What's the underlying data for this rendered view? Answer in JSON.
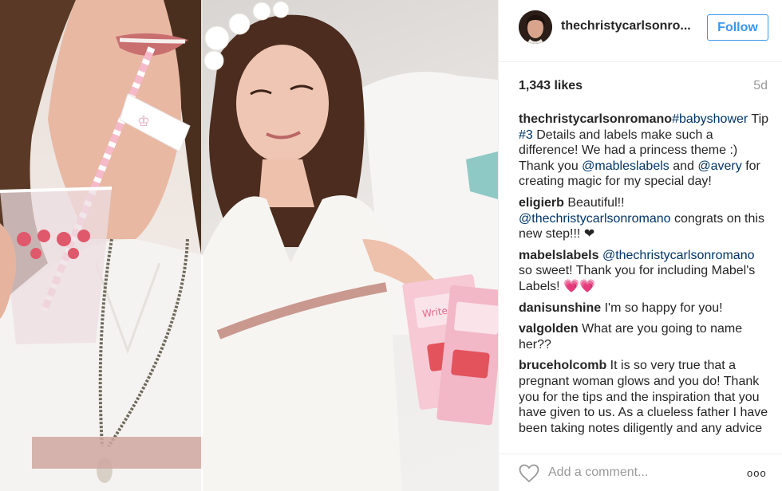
{
  "post": {
    "username_display": "thechristycarlsonro...",
    "follow_label": "Follow",
    "likes": "1,343 likes",
    "age": "5d"
  },
  "comments": [
    {
      "user": "thechristycarlsonromano",
      "parts": [
        {
          "t": "link",
          "v": "#babyshower"
        },
        {
          "t": "text",
          "v": " Tip "
        },
        {
          "t": "link",
          "v": "#3"
        },
        {
          "t": "text",
          "v": " Details and labels make such a difference! We had a princess theme :) Thank you "
        },
        {
          "t": "link",
          "v": "@mableslabels"
        },
        {
          "t": "text",
          "v": " and "
        },
        {
          "t": "link",
          "v": "@avery"
        },
        {
          "t": "text",
          "v": " for creating magic for my special day!"
        }
      ]
    },
    {
      "user": "eligierb",
      "parts": [
        {
          "t": "text",
          "v": " Beautiful!! "
        },
        {
          "t": "link",
          "v": "@thechristycarlsonromano"
        },
        {
          "t": "text",
          "v": " congrats on this new step!!! ❤"
        }
      ]
    },
    {
      "user": "mabelslabels",
      "parts": [
        {
          "t": "link",
          "v": " @thechristycarlsonromano"
        },
        {
          "t": "text",
          "v": " so sweet! Thank you for including Mabel's Labels! 💗💗"
        }
      ]
    },
    {
      "user": "danisunshine",
      "parts": [
        {
          "t": "text",
          "v": " I'm so happy for you!"
        }
      ]
    },
    {
      "user": "valgolden",
      "parts": [
        {
          "t": "text",
          "v": " What are you going to name her??"
        }
      ]
    },
    {
      "user": "bruceholcomb",
      "parts": [
        {
          "t": "text",
          "v": " It is so very true that a pregnant woman glows and you do! Thank you for the tips and the inspiration that you have given to us. As a clueless father I have been taking notes diligently and any advice"
        }
      ]
    }
  ],
  "footer": {
    "add_comment_placeholder": "Add a comment...",
    "more_label": "ooo"
  },
  "colors": {
    "follow_blue": "#3897f0",
    "link_blue": "#003569",
    "muted": "#999999"
  },
  "icons": {
    "like": "heart-outline-icon",
    "more": "more-options-icon"
  }
}
